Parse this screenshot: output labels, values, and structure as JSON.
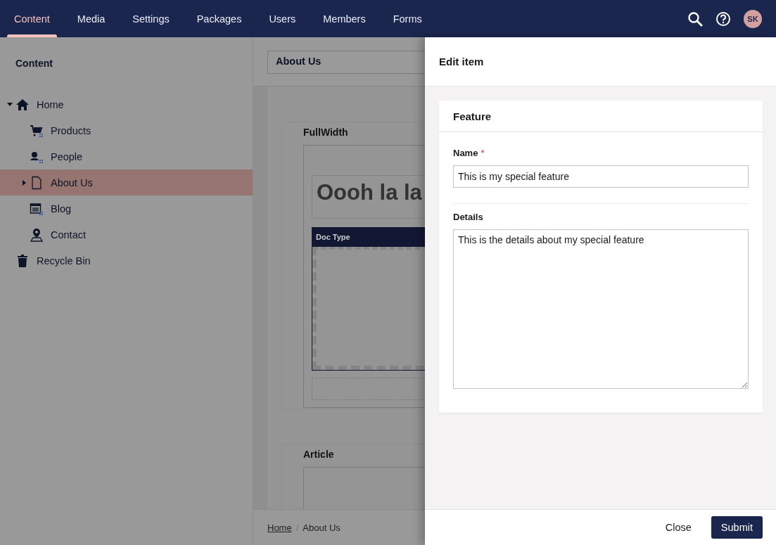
{
  "topnav": {
    "sections": [
      {
        "label": "Content",
        "selected": true
      },
      {
        "label": "Media",
        "selected": false
      },
      {
        "label": "Settings",
        "selected": false
      },
      {
        "label": "Packages",
        "selected": false
      },
      {
        "label": "Users",
        "selected": false
      },
      {
        "label": "Members",
        "selected": false
      },
      {
        "label": "Forms",
        "selected": false
      }
    ],
    "avatar": "SK"
  },
  "sidebar": {
    "title": "Content",
    "tree": [
      {
        "label": "Home",
        "kind": "home",
        "expanded": true,
        "selected": false,
        "children": [
          {
            "label": "Products",
            "kind": "cart",
            "selected": false
          },
          {
            "label": "People",
            "kind": "people",
            "selected": false
          },
          {
            "label": "About Us",
            "kind": "page",
            "expanded": false,
            "selected": true
          },
          {
            "label": "Blog",
            "kind": "calendar",
            "selected": false
          },
          {
            "label": "Contact",
            "kind": "pin",
            "selected": false
          }
        ]
      },
      {
        "label": "Recycle Bin",
        "kind": "bin",
        "selected": false
      }
    ]
  },
  "editor": {
    "page_name": "About Us",
    "sections": [
      {
        "title": "FullWidth",
        "heading": "Oooh la la",
        "block_title": "Doc Type"
      },
      {
        "title": "Article"
      }
    ],
    "breadcrumb": [
      {
        "label": "Home",
        "link": true
      },
      {
        "separator": "/"
      },
      {
        "label": "About Us",
        "link": false
      }
    ]
  },
  "panel": {
    "title": "Edit item",
    "card_title": "Feature",
    "fields": [
      {
        "label": "Name",
        "required_mark": "*",
        "kind": "text",
        "value": "This is my special feature"
      },
      {
        "label": "Details",
        "kind": "textarea",
        "value": "This is the details about my special feature"
      }
    ],
    "buttons": [
      {
        "label": "Close",
        "kind": "link"
      },
      {
        "label": "Submit",
        "kind": "primary"
      }
    ]
  }
}
